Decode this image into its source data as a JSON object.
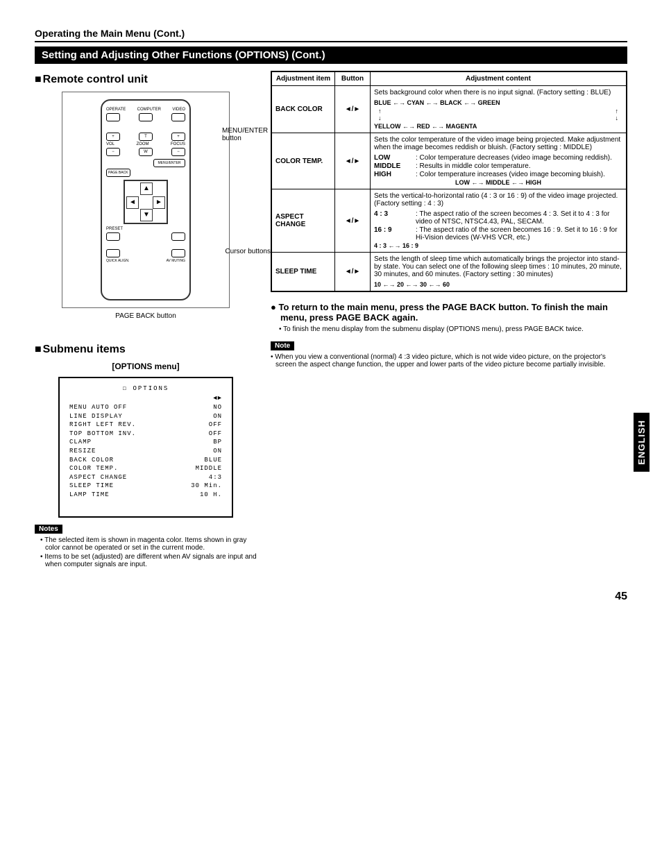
{
  "page_title": "Operating  the Main Menu (Cont.)",
  "banner": "Setting and Adjusting Other Functions (OPTIONS) (Cont.)",
  "remote_section_title": "Remote control unit",
  "remote": {
    "labels": {
      "operate": "OPERATE",
      "computer": "COMPUTER",
      "video": "VIDEO",
      "vol": "VOL",
      "zoom": "ZOOM",
      "focus": "FOCUS",
      "menu_enter": "MENU/ENTER",
      "page_back": "PAGE BACK",
      "preset": "PRESET",
      "quick_align": "QUICK ALIGN.",
      "av_muting": "AV MUTING",
      "plus": "+",
      "minus": "−",
      "t": "T",
      "w": "W"
    },
    "callouts": {
      "menu_enter": "MENU/ENTER button",
      "cursor": "Cursor buttons",
      "page_back": "PAGE BACK button"
    }
  },
  "submenu_section_title": "Submenu items",
  "submenu_caption": "[OPTIONS menu]",
  "options_panel": {
    "title": "OPTIONS",
    "items": [
      {
        "name": "MENU AUTO OFF",
        "value": "NO"
      },
      {
        "name": "LINE DISPLAY",
        "value": "ON"
      },
      {
        "name": "RIGHT LEFT REV.",
        "value": "OFF"
      },
      {
        "name": "TOP BOTTOM INV.",
        "value": "OFF"
      },
      {
        "name": "CLAMP",
        "value": "BP"
      },
      {
        "name": "RESIZE",
        "value": "ON"
      },
      {
        "name": "BACK COLOR",
        "value": "BLUE"
      },
      {
        "name": "COLOR TEMP.",
        "value": "MIDDLE"
      },
      {
        "name": "ASPECT CHANGE",
        "value": "4:3"
      },
      {
        "name": "SLEEP TIME",
        "value": "30  Min."
      },
      {
        "name": "LAMP TIME",
        "value": "10  H."
      }
    ]
  },
  "left_notes_tag": "Notes",
  "left_notes": [
    "The selected item is shown in magenta color. Items shown in gray color cannot be operated or set in the current mode.",
    "Items to be set (adjusted) are different when AV signals are input and when computer signals are input."
  ],
  "adj_headers": {
    "item": "Adjustment item",
    "button": "Button",
    "content": "Adjustment content"
  },
  "button_glyph": "◄/►",
  "adj_rows": [
    {
      "item": "BACK COLOR",
      "intro": "Sets background color when there is no input signal. (Factory setting : BLUE)",
      "seq1": "BLUE ←→ CYAN ←→ BLACK ←→ GREEN",
      "seq2": "YELLOW  ←→  RED  ←→  MAGENTA"
    },
    {
      "item": "COLOR TEMP.",
      "intro": "Sets the color temperature of the video image being projected. Make adjustment when the image becomes reddish or bluish. (Factory setting : MIDDLE)",
      "defs": [
        {
          "k": "LOW",
          "v": ": Color temperature decreases (video image becoming reddish)."
        },
        {
          "k": "MIDDLE",
          "v": ": Results in middle color temperature."
        },
        {
          "k": "HIGH",
          "v": ": Color temperature increases (video image becoming bluish)."
        }
      ],
      "seq": "LOW ←→ MIDDLE ←→ HIGH"
    },
    {
      "item": "ASPECT CHANGE",
      "intro": "Sets the vertical-to-horizontal ratio (4 : 3 or 16 : 9) of the video image projected. (Factory setting : 4 : 3)",
      "defs": [
        {
          "k": "4 : 3",
          "v": ": The aspect ratio of the screen becomes 4 : 3. Set it to 4 : 3 for video of NTSC, NTSC4.43, PAL, SECAM."
        },
        {
          "k": "16 : 9",
          "v": ": The aspect ratio of the screen becomes 16 : 9. Set it to 16 : 9 for Hi-Vision devices (W-VHS VCR, etc.)"
        }
      ],
      "seq": "4 : 3 ←→ 16 : 9"
    },
    {
      "item": "SLEEP TIME",
      "intro": "Sets the length of sleep time which automatically brings the projector into stand-by state. You can select one of the following sleep times : 10 minutes, 20 minute, 30 minutes, and 60 minutes. (Factory setting : 30 minutes)",
      "seq": "10 ←→ 20 ←→ 30 ←→ 60"
    }
  ],
  "return_heading": "To return to the main menu, press the PAGE BACK button. To finish the main menu, press PAGE BACK again.",
  "return_sub": "To finish the menu display from the submenu display (OPTIONS menu), press PAGE BACK twice.",
  "right_note_tag": "Note",
  "right_note": "When you view a conventional (normal) 4 :3 video picture, which is not wide video picture, on the projector's screen the aspect change function, the upper and lower parts of the video picture become partially invisible.",
  "side_tab": "ENGLISH",
  "page_number": "45"
}
